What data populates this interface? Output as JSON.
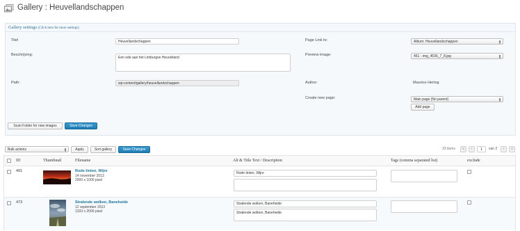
{
  "header": {
    "title": "Gallery : Heuvellandschappen",
    "icon": "gallery-icon"
  },
  "settings": {
    "title": "Gallery settings",
    "more_link": "(Click here for more settings)",
    "title_label": "Titel",
    "title_value": "Heuvellandschappen",
    "desc_label": "Beschrijving:",
    "desc_value": "Een ode aan het Limburgse Heuvelland",
    "path_label": "Path:",
    "path_value": "wp-content/gallery/heuvellandschappen",
    "page_link_label": "Page Link to:",
    "page_link_value": "Album: Heuvellandschappen",
    "preview_label": "Preview image:",
    "preview_value": "451 - img_4536_7_8.jpg",
    "author_label": "Author:",
    "author_value": "Maurice Hertog",
    "create_page_label": "Create new page:",
    "create_page_value": "Main page (No parent)",
    "add_page_label": "Add page",
    "scan_label": "Scan Folder for new images",
    "save_label": "Save Changes"
  },
  "toolbar": {
    "bulk_label": "Bulk actions",
    "apply_label": "Apply",
    "sort_label": "Sort gallery",
    "save_label": "Save Changes",
    "items_count": "33 items",
    "first": "«",
    "prev": "‹",
    "page": "1",
    "of_pages": "van 2",
    "next": "›",
    "last": "»"
  },
  "table": {
    "columns": {
      "id": "ID",
      "thumbnail": "Thumbnail",
      "filename": "Filename",
      "alt": "Alt & Title Text / Description",
      "tags": "Tags (comma separated list)",
      "exclude": "exclude"
    },
    "rows": [
      {
        "id": "491",
        "filename": "Rode tinten, Wijre",
        "date": "14 november 2013",
        "size": "2000 x 1000 pixel",
        "alt_text": "Rode tinten, Wijre",
        "description": ""
      },
      {
        "id": "473",
        "filename": "Stralende wolken, Baneheide",
        "date": "12 september 2013",
        "size": "1333 x 2000 pixel",
        "alt_text": "Stralende wolken, Baneheide",
        "description": "Stralende wolken, Baneheide"
      }
    ]
  },
  "colors": {
    "accent": "#21759b",
    "primary_button": "#2a8ac4",
    "panel_bg": "#f5f9fc"
  }
}
